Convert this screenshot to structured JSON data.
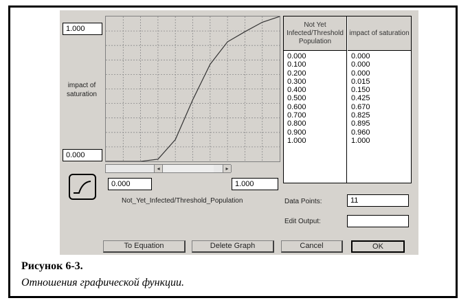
{
  "y_axis": {
    "max_value": "1.000",
    "min_value": "0.000",
    "label": "impact of saturation"
  },
  "x_axis": {
    "min_value": "0.000",
    "max_value": "1.000",
    "label": "Not_Yet_Infected/Threshold_Population"
  },
  "table": {
    "col1_header": "Not Yet Infected/Threshold Population",
    "col2_header": "impact of saturation",
    "col1_values": [
      "0.000",
      "0.100",
      "0.200",
      "0.300",
      "0.400",
      "0.500",
      "0.600",
      "0.700",
      "0.800",
      "0.900",
      "1.000"
    ],
    "col2_values": [
      "0.000",
      "0.000",
      "0.000",
      "0.015",
      "0.150",
      "0.425",
      "0.670",
      "0.825",
      "0.895",
      "0.960",
      "1.000"
    ]
  },
  "form": {
    "data_points_label": "Data Points:",
    "data_points_value": "11",
    "edit_output_label": "Edit Output:",
    "edit_output_value": ""
  },
  "buttons": {
    "to_equation": "To Equation",
    "delete_graph": "Delete Graph",
    "cancel": "Cancel",
    "ok": "OK"
  },
  "caption": {
    "figure": "Рисунок 6-3.",
    "text": "Отношения графической функции."
  },
  "chart_data": {
    "type": "line",
    "x": [
      0.0,
      0.1,
      0.2,
      0.3,
      0.4,
      0.5,
      0.6,
      0.7,
      0.8,
      0.9,
      1.0
    ],
    "values": [
      0.0,
      0.0,
      0.0,
      0.015,
      0.15,
      0.425,
      0.67,
      0.825,
      0.895,
      0.96,
      1.0
    ],
    "xlim": [
      0,
      1
    ],
    "ylim": [
      0,
      1
    ],
    "grid": true
  }
}
